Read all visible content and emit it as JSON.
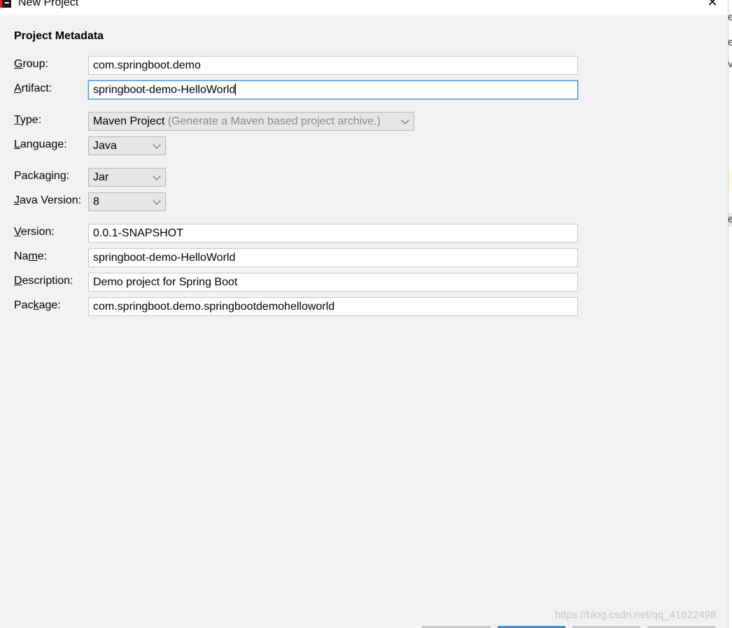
{
  "window": {
    "title": "New Project",
    "close_glyph": "✕"
  },
  "section_title": "Project Metadata",
  "form": {
    "group": {
      "label_first": "G",
      "label_rest": "roup:",
      "value": "com.springboot.demo"
    },
    "artifact": {
      "label_first": "A",
      "label_rest": "rtifact:",
      "value": "springboot-demo-HelloWorld"
    },
    "type": {
      "label_first": "T",
      "label_rest": "ype:",
      "value": "Maven Project",
      "hint": "(Generate a Maven based project archive.)"
    },
    "language": {
      "label_first": "L",
      "label_rest": "anguage:",
      "value": "Java"
    },
    "packaging": {
      "label_pre": "Packa",
      "label_ul": "g",
      "label_post": "ing:",
      "value": "Jar"
    },
    "java_version": {
      "label_first": "J",
      "label_rest": "ava Version:",
      "value": "8"
    },
    "version": {
      "label_first": "V",
      "label_rest": "ersion:",
      "value": "0.0.1-SNAPSHOT"
    },
    "name": {
      "label_pre": "Na",
      "label_ul": "m",
      "label_post": "e:",
      "value": "springboot-demo-HelloWorld"
    },
    "description": {
      "label_first": "D",
      "label_rest": "escription:",
      "value": "Demo project for Spring Boot"
    },
    "package": {
      "label_pre": "Pac",
      "label_ul": "k",
      "label_post": "age:",
      "value": "com.springboot.demo.springbootdemohelloworld"
    }
  },
  "right_strip": {
    "line1": "e",
    "line2": "e",
    "line3": "v",
    "line4": "e"
  },
  "watermark": "https://blog.csdn.net/qq_41622498",
  "colors": {
    "background": "#f2f2f2",
    "focus_border": "#3d8ee6",
    "hint_text": "#8c8c8c",
    "primary_button_strip": "#3d8ee6"
  },
  "icons": {
    "app": "intellij-idea-icon",
    "close": "close-icon",
    "dropdown": "chevron-down-icon"
  }
}
